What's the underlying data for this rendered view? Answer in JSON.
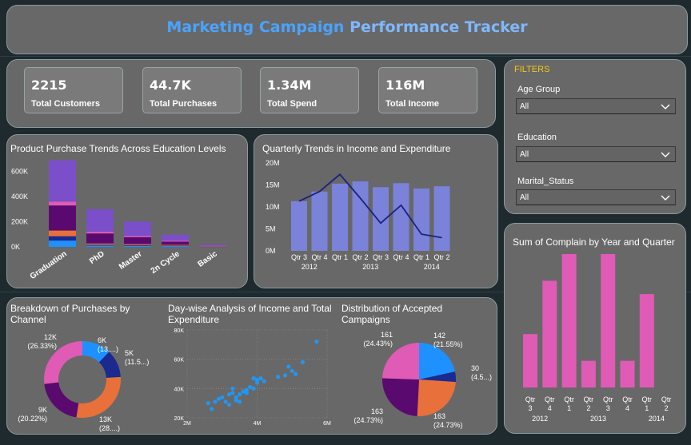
{
  "title": {
    "part1": "Marketing Campaign",
    "part2": "Performance Tracker"
  },
  "colors": {
    "bg": "#1f2a2e",
    "panel": "#686868",
    "title_blue": "#4aa3ff",
    "filter_title": "#f2c811",
    "purple": "#7b4fc9",
    "pink": "#e05bb5",
    "dark_purple": "#5a0a6e",
    "orange": "#e8703a",
    "blue": "#1e90ff",
    "navy": "#1a2a8f",
    "bar_periwinkle": "#7b82d9",
    "line_navy": "#1a237e",
    "scatter_blue": "#2196f3"
  },
  "kpis": [
    {
      "value": "2215",
      "label": "Total Customers"
    },
    {
      "value": "44.7K",
      "label": "Total Purchases"
    },
    {
      "value": "1.34M",
      "label": "Total Spend"
    },
    {
      "value": "116M",
      "label": "Total Income"
    }
  ],
  "filters": {
    "title": "FILTERS",
    "items": [
      {
        "label": "Age Group",
        "value": "All"
      },
      {
        "label": "Education",
        "value": "All"
      },
      {
        "label": "Marital_Status",
        "value": "All"
      }
    ]
  },
  "panels": {
    "education": "Product Purchase Trends Across Education Levels",
    "quarterly": "Quarterly Trends in Income and Expenditure",
    "complain": "Sum of Complain by Year and Quarter",
    "channel": "Breakdown of Purchases by Channel",
    "daywise": "Day-wise Analysis of Income and Total Expenditure",
    "accepted": "Distribution of Accepted Campaigns"
  },
  "chart_data": [
    {
      "id": "education",
      "type": "bar",
      "stacked": true,
      "categories": [
        "Graduation",
        "PhD",
        "Master",
        "2n Cycle",
        "Basic"
      ],
      "yticks": [
        "0K",
        "200K",
        "400K",
        "600K"
      ],
      "ylim": [
        0,
        700000
      ],
      "series": [
        {
          "color": "#1e90ff",
          "values": [
            50000,
            10000,
            8000,
            6000,
            1000
          ]
        },
        {
          "color": "#1a2a8f",
          "values": [
            35000,
            7000,
            6000,
            4000,
            1000
          ]
        },
        {
          "color": "#e8703a",
          "values": [
            45000,
            10000,
            8000,
            6000,
            1000
          ]
        },
        {
          "color": "#5a0a6e",
          "values": [
            200000,
            80000,
            55000,
            26000,
            4000
          ]
        },
        {
          "color": "#e05bb5",
          "values": [
            30000,
            13000,
            9000,
            6000,
            1000
          ]
        },
        {
          "color": "#7b4fc9",
          "values": [
            330000,
            180000,
            115000,
            50000,
            8000
          ]
        }
      ]
    },
    {
      "id": "quarterly",
      "type": "bar",
      "categories": [
        "Qtr 3",
        "Qtr 4",
        "Qtr 1",
        "Qtr 2",
        "Qtr 3",
        "Qtr 4",
        "Qtr 1",
        "Qtr 2"
      ],
      "years": [
        {
          "label": "2012",
          "span": [
            0,
            1
          ]
        },
        {
          "label": "2013",
          "span": [
            2,
            5
          ]
        },
        {
          "label": "2014",
          "span": [
            6,
            7
          ]
        }
      ],
      "yticks": [
        "0M",
        "5M",
        "10M",
        "15M",
        "20M"
      ],
      "ylim": [
        0,
        20000000
      ],
      "bars": [
        11300000,
        13500000,
        15300000,
        15800000,
        14500000,
        15400000,
        14200000,
        14700000
      ],
      "line": [
        11300000,
        13500000,
        17400000,
        12000000,
        6300000,
        10400000,
        3800000,
        3000000
      ]
    },
    {
      "id": "complain",
      "type": "bar",
      "categories": [
        "Qtr 3",
        "Qtr 4",
        "Qtr 1",
        "Qtr 2",
        "Qtr 3",
        "Qtr 4",
        "Qtr 1",
        "Qtr 2"
      ],
      "years": [
        {
          "label": "2012",
          "span": [
            0,
            1
          ]
        },
        {
          "label": "2013",
          "span": [
            2,
            5
          ]
        },
        {
          "label": "2014",
          "span": [
            6,
            7
          ]
        }
      ],
      "values": [
        4,
        8,
        10,
        2,
        10,
        2,
        7,
        0
      ],
      "ylim": [
        0,
        10
      ]
    },
    {
      "id": "channel",
      "type": "pie",
      "donut": true,
      "slices": [
        {
          "value": 12,
          "color": "#1e90ff",
          "label": "6K (13....)"
        },
        {
          "value": 11.5,
          "color": "#1a2a8f",
          "label": "5K (11.5...)"
        },
        {
          "value": 28,
          "color": "#e8703a",
          "label": "13K (28....)"
        },
        {
          "value": 20.22,
          "color": "#5a0a6e",
          "label": "9K (20.22%)"
        },
        {
          "value": 26.33,
          "color": "#e05bb5",
          "label": "12K (26.33%)"
        }
      ]
    },
    {
      "id": "daywise",
      "type": "scatter",
      "xticks": [
        "2M",
        "4M",
        "6M"
      ],
      "yticks": [
        "20K",
        "40K",
        "60K",
        "80K"
      ],
      "xlim": [
        2000000,
        6000000
      ],
      "ylim": [
        20000,
        80000
      ],
      "points": [
        [
          2.6,
          30
        ],
        [
          2.7,
          26
        ],
        [
          2.8,
          31
        ],
        [
          2.9,
          33
        ],
        [
          3.0,
          34
        ],
        [
          3.1,
          31
        ],
        [
          3.2,
          36
        ],
        [
          3.3,
          37
        ],
        [
          3.4,
          34
        ],
        [
          3.5,
          36
        ],
        [
          3.6,
          38
        ],
        [
          3.7,
          39
        ],
        [
          3.8,
          41
        ],
        [
          3.9,
          40
        ],
        [
          4.0,
          44
        ],
        [
          4.0,
          46
        ],
        [
          4.1,
          47
        ],
        [
          4.2,
          45
        ],
        [
          3.4,
          32
        ],
        [
          3.2,
          29
        ],
        [
          3.3,
          40
        ],
        [
          3.5,
          31
        ],
        [
          3.7,
          37
        ],
        [
          4.6,
          48
        ],
        [
          4.8,
          49
        ],
        [
          5.0,
          52
        ],
        [
          4.9,
          55
        ],
        [
          5.1,
          50
        ],
        [
          5.3,
          58
        ],
        [
          5.7,
          72
        ],
        [
          3.9,
          47
        ]
      ]
    },
    {
      "id": "accepted",
      "type": "pie",
      "slices": [
        {
          "value": 21.55,
          "color": "#1e90ff",
          "label": "142 (21.55%)"
        },
        {
          "value": 4.5,
          "color": "#1a2a8f",
          "label": "30 (4.5...)"
        },
        {
          "value": 24.73,
          "color": "#e8703a",
          "label": "163 (24.73%)"
        },
        {
          "value": 24.73,
          "color": "#5a0a6e",
          "label": "163 (24.73%)"
        },
        {
          "value": 24.43,
          "color": "#e05bb5",
          "label": "161 (24.43%)"
        }
      ]
    }
  ]
}
